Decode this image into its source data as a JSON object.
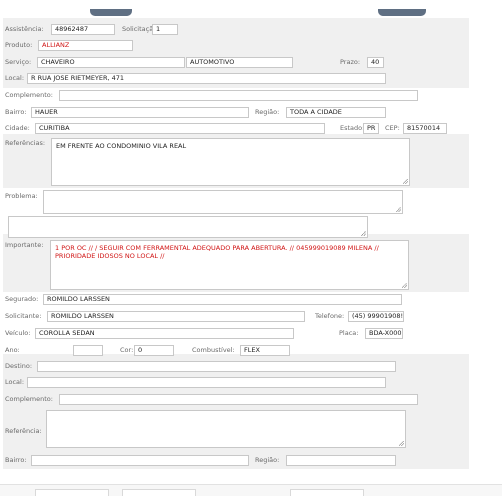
{
  "fields": {
    "assistencia": {
      "label": "Assistência:",
      "value": "48962487"
    },
    "solicitacao": {
      "label": "Solicitação:",
      "value": "1"
    },
    "produto": {
      "label": "Produto:",
      "value": "ALLIANZ"
    },
    "servico": {
      "label": "Serviço:",
      "value": "CHAVEIRO"
    },
    "servico_tipo": {
      "value": "AUTOMOTIVO"
    },
    "prazo": {
      "label": "Prazo:",
      "value": "40"
    },
    "local": {
      "label": "Local:",
      "value": "R RUA JOSE RIETMEYER, 471"
    },
    "complemento": {
      "label": "Complemento:",
      "value": ""
    },
    "bairro": {
      "label": "Bairro:",
      "value": "HAUER"
    },
    "regiao": {
      "label": "Região:",
      "value": "TODA A CIDADE"
    },
    "cidade": {
      "label": "Cidade:",
      "value": "CURITIBA"
    },
    "estado": {
      "label": "Estado:",
      "value": "PR"
    },
    "cep": {
      "label": "CEP:",
      "value": "81570014"
    },
    "referencias": {
      "label": "Referências:",
      "value": "EM FRENTE AO CONDOMINIO VILA REAL"
    },
    "problema": {
      "label": "Problema:",
      "value": ""
    },
    "extra_text": {
      "value": ""
    },
    "importante": {
      "label": "Importante:",
      "value": "1 POR OC //  / SEGUIR COM FERRAMENTAL ADEQUADO PARA ABERTURA. // 045999019089 MILENA // PRIORIDADE IDOSOS NO LOCAL //"
    },
    "segurado": {
      "label": "Segurado:",
      "value": "ROMILDO LARSSEN"
    },
    "solicitante": {
      "label": "Solicitante:",
      "value": "ROMILDO LARSSEN"
    },
    "telefone": {
      "label": "Telefone:",
      "value": "(45) 99901908!"
    },
    "veiculo": {
      "label": "Veículo:",
      "value": "COROLLA SEDAN"
    },
    "placa": {
      "label": "Placa:",
      "value": "BDA-X000"
    },
    "ano": {
      "label": "Ano:",
      "value": ""
    },
    "cor": {
      "label": "Cor:",
      "value": "0"
    },
    "combustivel": {
      "label": "Combustível:",
      "value": "FLEX"
    },
    "destino": {
      "label": "Destino:",
      "value": ""
    },
    "destino_local": {
      "label": "Local:",
      "value": ""
    },
    "destino_complemento": {
      "label": "Complemento:",
      "value": ""
    },
    "destino_referencia": {
      "label": "Referência:",
      "value": ""
    },
    "destino_bairro": {
      "label": "Bairro:",
      "value": ""
    },
    "destino_regiao": {
      "label": "Região:",
      "value": ""
    }
  },
  "colors": {
    "red_text": "#d01414",
    "band": "#f0f0f0",
    "tab": "#5f6f83"
  }
}
